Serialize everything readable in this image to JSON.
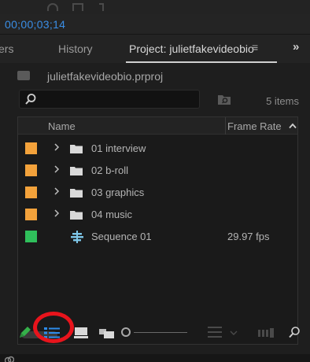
{
  "timecode": "00;00;03;14",
  "tabs": [
    {
      "label": "ers"
    },
    {
      "label": "History"
    },
    {
      "label": "Project: julietfakevideobio",
      "active": true
    }
  ],
  "tab_menu_glyph": "≡",
  "tab_overflow_glyph": "»",
  "project": {
    "file_name": "julietfakevideobio.prproj"
  },
  "search": {
    "value": "",
    "placeholder": ""
  },
  "item_count": "5 items",
  "columns": {
    "name": "Name",
    "frame_rate": "Frame Rate"
  },
  "rows": [
    {
      "name": "01 interview",
      "type": "bin",
      "frame_rate": "",
      "label_color": "#f3a23b"
    },
    {
      "name": "02 b-roll",
      "type": "bin",
      "frame_rate": "",
      "label_color": "#f3a23b"
    },
    {
      "name": "03 graphics",
      "type": "bin",
      "frame_rate": "",
      "label_color": "#f3a23b"
    },
    {
      "name": "04 music",
      "type": "bin",
      "frame_rate": "",
      "label_color": "#f3a23b"
    },
    {
      "name": "Sequence 01",
      "type": "sequence",
      "frame_rate": "29.97 fps",
      "label_color": "#2fbf5b"
    }
  ],
  "colors": {
    "timecode": "#3a8ee6",
    "accent_blue": "#2d8ceb",
    "highlight_ring": "#e8141c",
    "pen_green": "#35b04a"
  },
  "toolbar_icons": [
    "pencil-icon",
    "list-view-icon",
    "icon-view-icon",
    "freeform-view-icon",
    "zoom-slider",
    "sort-icons-icon",
    "automate-to-sequence-icon",
    "find-icon"
  ]
}
